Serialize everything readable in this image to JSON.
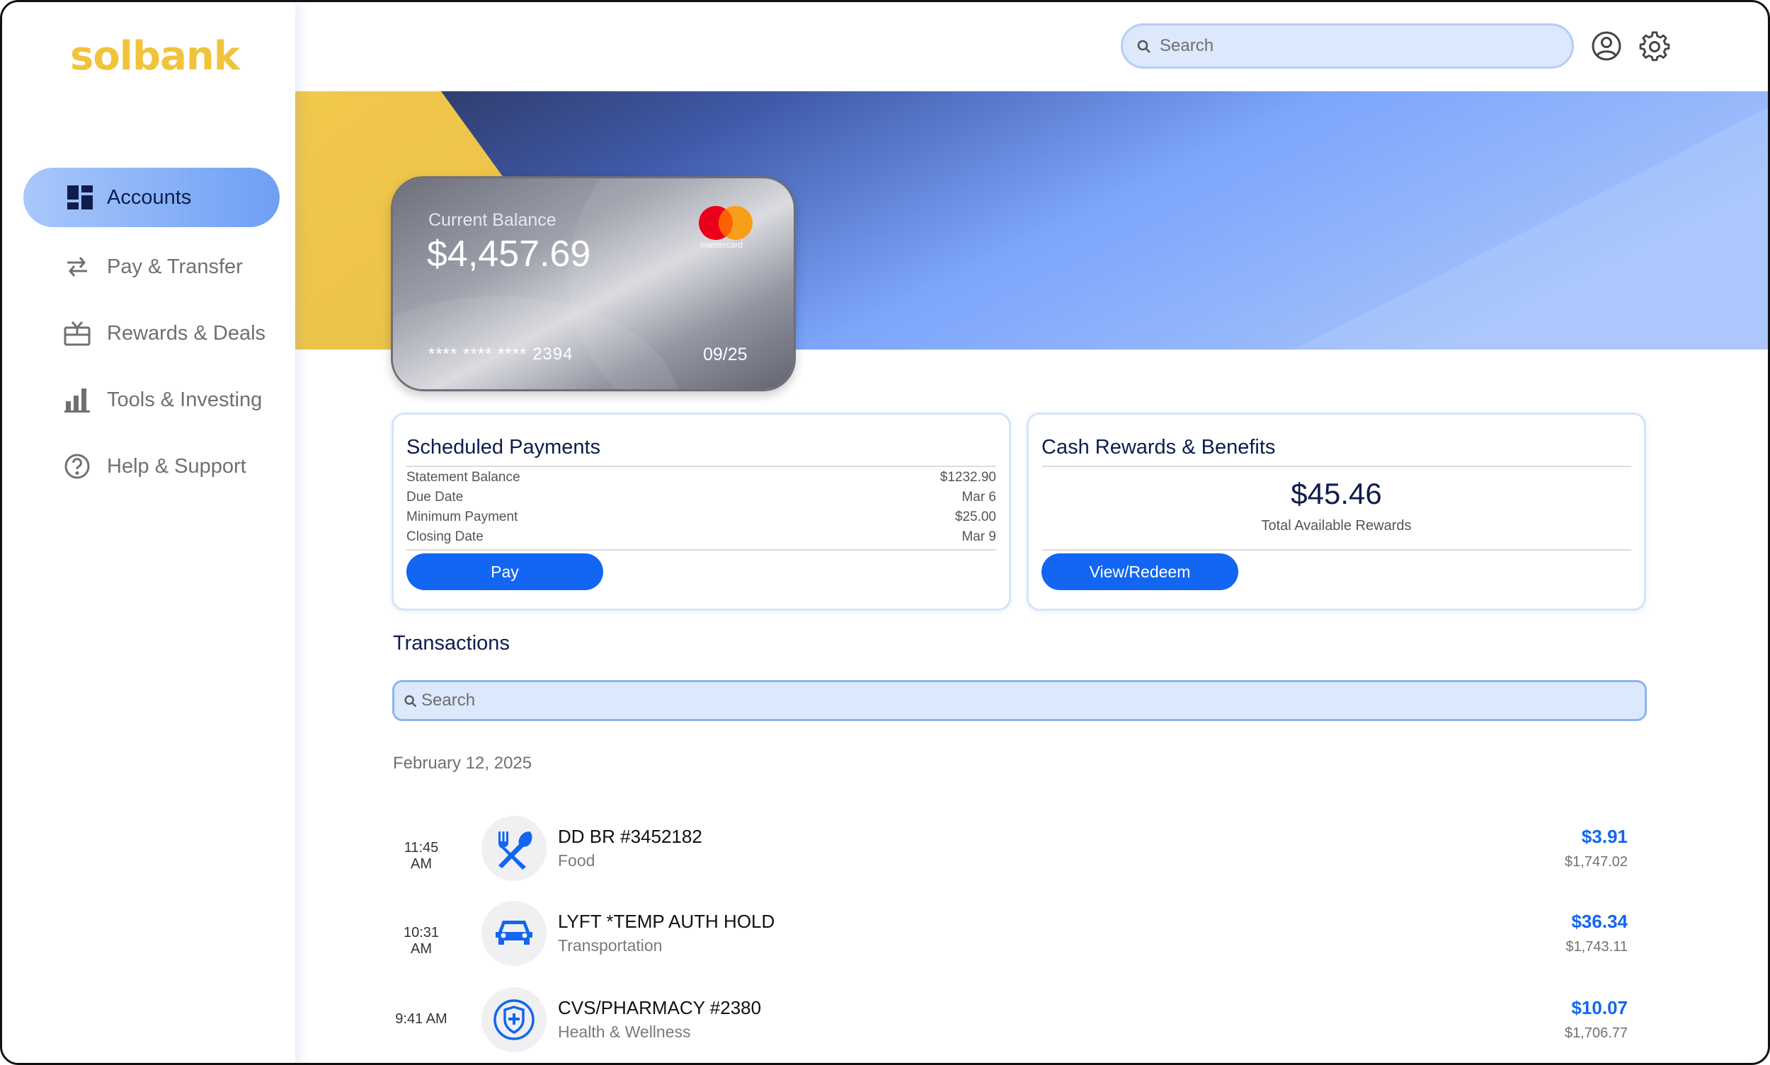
{
  "brand": {
    "name": "solbank",
    "color": "#f0c43a"
  },
  "colors": {
    "accent": "#1266f1",
    "navy": "#0f1c4d",
    "search_bg": "#dce8fb"
  },
  "sidebar": {
    "items": [
      {
        "label": "Accounts",
        "icon": "dashboard-icon",
        "active": true
      },
      {
        "label": "Pay & Transfer",
        "icon": "transfer-arrows-icon",
        "active": false
      },
      {
        "label": "Rewards & Deals",
        "icon": "gift-icon",
        "active": false
      },
      {
        "label": "Tools & Investing",
        "icon": "bar-chart-icon",
        "active": false
      },
      {
        "label": "Help & Support",
        "icon": "help-circle-icon",
        "active": false
      }
    ]
  },
  "header": {
    "search": {
      "placeholder": "Search",
      "value": ""
    },
    "user_icon": "user-circle-icon",
    "settings_icon": "gear-icon"
  },
  "card": {
    "label": "Current Balance",
    "balance": "$4,457.69",
    "number_masked": "**** **** **** 2394",
    "expiry": "09/25",
    "network": "mastercard"
  },
  "scheduled_payments": {
    "title": "Scheduled Payments",
    "rows": [
      {
        "label": "Statement Balance",
        "value": "$1232.90"
      },
      {
        "label": "Due Date",
        "value": "Mar 6"
      },
      {
        "label": "Minimum Payment",
        "value": "$25.00"
      },
      {
        "label": "Closing Date",
        "value": "Mar 9"
      }
    ],
    "button": "Pay"
  },
  "rewards": {
    "title": "Cash Rewards & Benefits",
    "amount": "$45.46",
    "subtitle": "Total Available Rewards",
    "button": "View/Redeem"
  },
  "transactions": {
    "title": "Transactions",
    "search": {
      "placeholder": "Search",
      "value": ""
    },
    "date": "February 12, 2025",
    "items": [
      {
        "time": "11:45 AM",
        "merchant": "DD BR #3452182",
        "category": "Food",
        "amount": "$3.91",
        "balance": "$1,747.02",
        "icon": "fork-spoon-icon"
      },
      {
        "time": "10:31 AM",
        "merchant": "LYFT *TEMP AUTH HOLD",
        "category": "Transportation",
        "amount": "$36.34",
        "balance": "$1,743.11",
        "icon": "car-icon"
      },
      {
        "time": "9:41 AM",
        "merchant": "CVS/PHARMACY #2380",
        "category": "Health & Wellness",
        "amount": "$10.07",
        "balance": "$1,706.77",
        "icon": "medical-shield-icon"
      }
    ]
  }
}
